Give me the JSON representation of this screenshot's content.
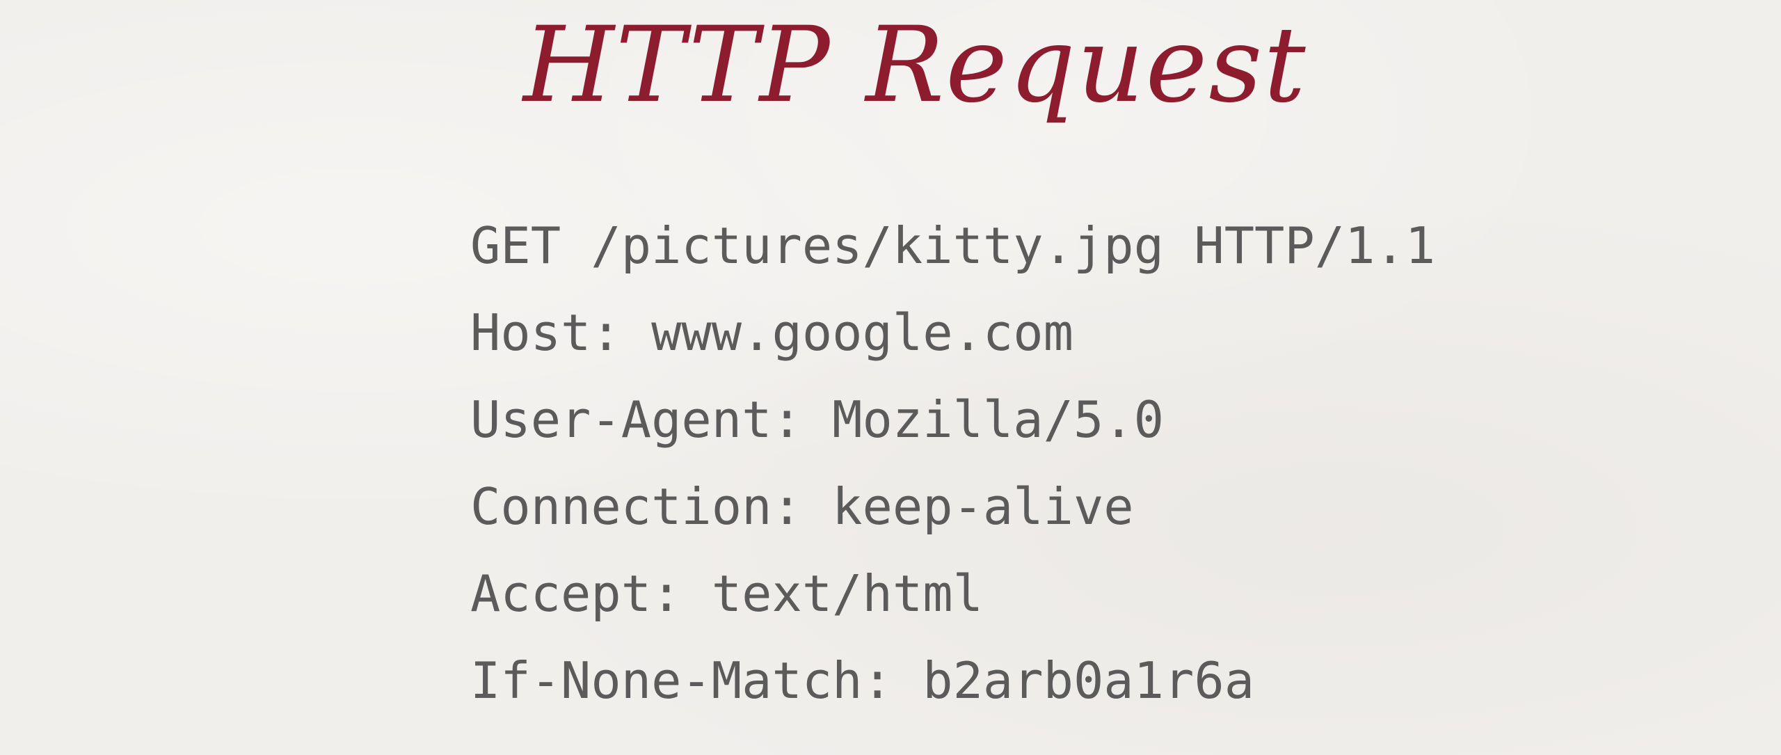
{
  "slide": {
    "title": "HTTP Request",
    "request_lines": [
      "GET /pictures/kitty.jpg HTTP/1.1",
      "Host: www.google.com",
      "User-Agent: Mozilla/5.0",
      "Connection: keep-alive",
      "Accept: text/html",
      "If-None-Match: b2arb0a1r6a"
    ]
  },
  "colors": {
    "background": "#f1efec",
    "title": "#8c1c2e",
    "body_text": "#5b5b5b"
  }
}
